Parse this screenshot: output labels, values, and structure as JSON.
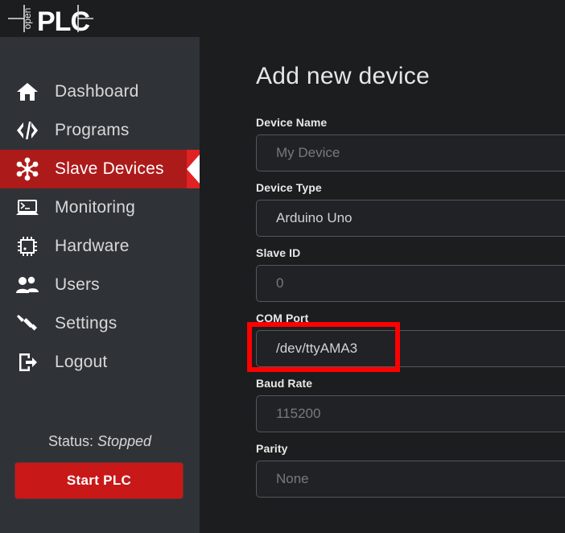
{
  "brand": {
    "logo_text_vertical": "open",
    "logo_text_main": "PLC"
  },
  "sidebar": {
    "items": [
      {
        "label": "Dashboard",
        "icon": "home-icon",
        "active": false
      },
      {
        "label": "Programs",
        "icon": "code-icon",
        "active": false
      },
      {
        "label": "Slave Devices",
        "icon": "network-icon",
        "active": true
      },
      {
        "label": "Monitoring",
        "icon": "laptop-icon",
        "active": false
      },
      {
        "label": "Hardware",
        "icon": "chip-icon",
        "active": false
      },
      {
        "label": "Users",
        "icon": "users-icon",
        "active": false
      },
      {
        "label": "Settings",
        "icon": "screwdriver-icon",
        "active": false
      },
      {
        "label": "Logout",
        "icon": "logout-icon",
        "active": false
      }
    ],
    "status_prefix": "Status:",
    "status_value": "Stopped",
    "start_button": "Start PLC"
  },
  "main": {
    "title": "Add new device",
    "fields": [
      {
        "label": "Device Name",
        "value": "My Device",
        "is_placeholder": true,
        "highlighted": false
      },
      {
        "label": "Device Type",
        "value": "Arduino Uno",
        "is_placeholder": false,
        "highlighted": false
      },
      {
        "label": "Slave ID",
        "value": "0",
        "is_placeholder": true,
        "highlighted": false
      },
      {
        "label": "COM Port",
        "value": "/dev/ttyAMA3",
        "is_placeholder": false,
        "highlighted": true
      },
      {
        "label": "Baud Rate",
        "value": "115200",
        "is_placeholder": true,
        "highlighted": false
      },
      {
        "label": "Parity",
        "value": "None",
        "is_placeholder": true,
        "highlighted": false
      }
    ]
  },
  "colors": {
    "sidebar_bg": "#2f3337",
    "main_bg": "#1b1d1f",
    "active_red": "#ad1a1a",
    "accent_red": "#e02222",
    "button_red": "#c81818",
    "highlight_red": "#fe0000"
  }
}
